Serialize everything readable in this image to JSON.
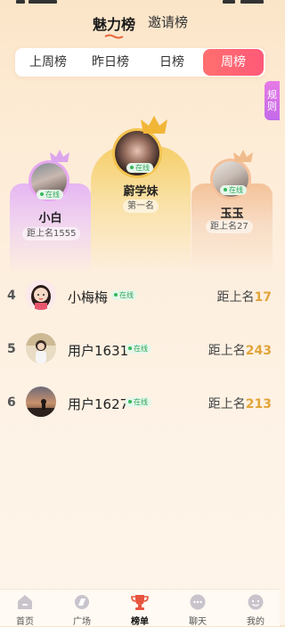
{
  "top_tabs": {
    "active": "魅力榜",
    "inactive": "邀请榜"
  },
  "periods": [
    {
      "label": "上周榜",
      "active": false
    },
    {
      "label": "昨日榜",
      "active": false
    },
    {
      "label": "日榜",
      "active": false
    },
    {
      "label": "周榜",
      "active": true
    }
  ],
  "rules_tab": {
    "line1": "规",
    "line2": "则"
  },
  "online_label": "在线",
  "podium": {
    "first": {
      "name": "蔚学妹",
      "gap": "第一名"
    },
    "second": {
      "name": "小白",
      "gap": "距上名1555"
    },
    "third": {
      "name": "玉玉",
      "gap": "距上名27"
    }
  },
  "ranking": [
    {
      "rank": "4",
      "name": "小梅梅",
      "gap_prefix": "距上名",
      "gap_value": "17"
    },
    {
      "rank": "5",
      "name": "用户1631",
      "gap_prefix": "距上名",
      "gap_value": "243"
    },
    {
      "rank": "6",
      "name": "用户1627",
      "gap_prefix": "距上名",
      "gap_value": "213"
    }
  ],
  "bottom_nav": [
    {
      "label": "首页",
      "icon": "home-icon",
      "active": false
    },
    {
      "label": "广场",
      "icon": "square-icon",
      "active": false
    },
    {
      "label": "榜单",
      "icon": "trophy-icon",
      "active": true
    },
    {
      "label": "聊天",
      "icon": "chat-icon",
      "active": false
    },
    {
      "label": "我的",
      "icon": "profile-icon",
      "active": false
    }
  ],
  "colors": {
    "accent": "#ff5a78",
    "gold": "#e2a53a",
    "online": "#34b85e"
  }
}
